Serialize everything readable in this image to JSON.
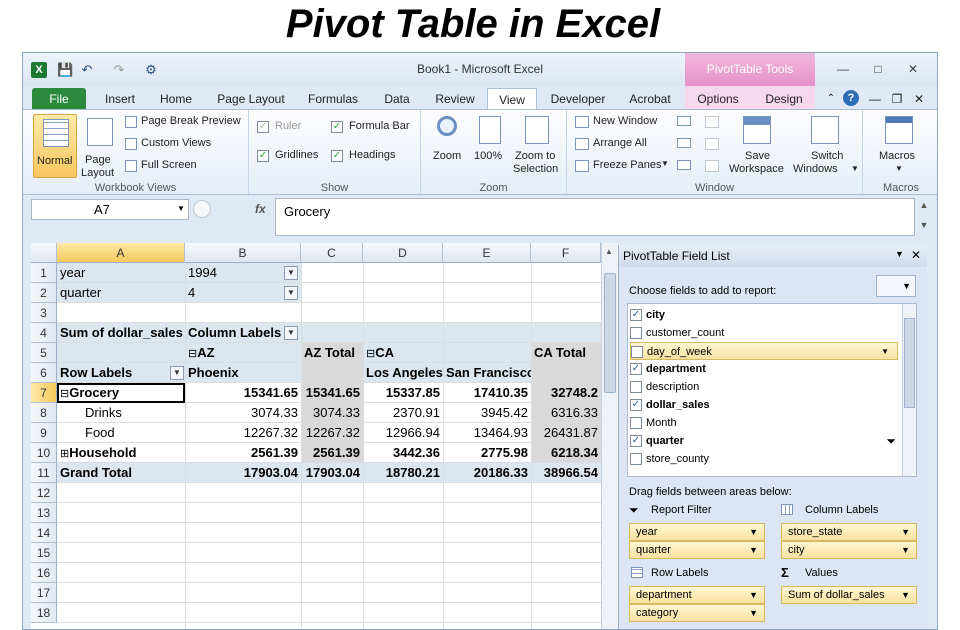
{
  "heading": "Pivot Table in Excel",
  "window": {
    "title": "Book1  -  Microsoft Excel",
    "contextual_tab": "PivotTable Tools",
    "tabs": [
      "File",
      "Insert",
      "Home",
      "Page Layout",
      "Formulas",
      "Data",
      "Review",
      "View",
      "Developer",
      "Acrobat",
      "Options",
      "Design"
    ],
    "active_tab": "View"
  },
  "ribbon": {
    "workbook_views": {
      "label": "Workbook Views",
      "normal": "Normal",
      "page_layout_1": "Page",
      "page_layout_2": "Layout",
      "page_break": "Page Break Preview",
      "custom_views": "Custom Views",
      "full_screen": "Full Screen"
    },
    "show": {
      "label": "Show",
      "ruler": "Ruler",
      "formula_bar": "Formula Bar",
      "gridlines": "Gridlines",
      "headings": "Headings"
    },
    "zoom": {
      "label": "Zoom",
      "zoom": "Zoom",
      "pct": "100%",
      "zoom_sel_1": "Zoom to",
      "zoom_sel_2": "Selection"
    },
    "window": {
      "label": "Window",
      "new_window": "New Window",
      "arrange_all": "Arrange All",
      "freeze_panes": "Freeze Panes",
      "save_ws_1": "Save",
      "save_ws_2": "Workspace",
      "switch_1": "Switch",
      "switch_2": "Windows"
    },
    "macros": {
      "label": "Macros",
      "macros": "Macros"
    }
  },
  "formula_bar": {
    "name_box": "A7",
    "fx": "fx",
    "value": "Grocery"
  },
  "sheet": {
    "columns": [
      "A",
      "B",
      "C",
      "D",
      "E",
      "F"
    ],
    "rows": [
      "1",
      "2",
      "3",
      "4",
      "5",
      "6",
      "7",
      "8",
      "9",
      "10",
      "11",
      "12",
      "13",
      "14",
      "15",
      "16",
      "17",
      "18"
    ],
    "filters": [
      {
        "field": "year",
        "value": "1994"
      },
      {
        "field": "quarter",
        "value": "4"
      }
    ],
    "values_label": "Sum of dollar_sales",
    "column_labels": "Column Labels",
    "row_labels": "Row Labels",
    "states": {
      "az": "AZ",
      "ca": "CA",
      "az_total": "AZ Total",
      "ca_total": "CA Total"
    },
    "cities": [
      "Phoenix",
      "Los Angeles",
      "San Francisco"
    ],
    "data_rows": [
      {
        "label": "Grocery",
        "expander": "⊟",
        "vals": [
          "15341.65",
          "15341.65",
          "15337.85",
          "17410.35",
          "32748.2"
        ]
      },
      {
        "label": "Drinks",
        "expander": "",
        "vals": [
          "3074.33",
          "3074.33",
          "2370.91",
          "3945.42",
          "6316.33"
        ]
      },
      {
        "label": "Food",
        "expander": "",
        "vals": [
          "12267.32",
          "12267.32",
          "12966.94",
          "13464.93",
          "26431.87"
        ]
      },
      {
        "label": "Household",
        "expander": "⊞",
        "vals": [
          "2561.39",
          "2561.39",
          "3442.36",
          "2775.98",
          "6218.34"
        ]
      },
      {
        "label": "Grand Total",
        "expander": "",
        "vals": [
          "17903.04",
          "17903.04",
          "18780.21",
          "20186.33",
          "38966.54"
        ]
      }
    ]
  },
  "field_list": {
    "title": "PivotTable Field List",
    "choose": "Choose fields to add to report:",
    "fields": [
      {
        "name": "city",
        "checked": true
      },
      {
        "name": "customer_count",
        "checked": false
      },
      {
        "name": "day_of_week",
        "checked": false
      },
      {
        "name": "department",
        "checked": true
      },
      {
        "name": "description",
        "checked": false
      },
      {
        "name": "dollar_sales",
        "checked": true
      },
      {
        "name": "Month",
        "checked": false
      },
      {
        "name": "quarter",
        "checked": true
      },
      {
        "name": "store_county",
        "checked": false
      }
    ],
    "drag": "Drag fields between areas below:",
    "report_filter": "Report Filter",
    "column_labels": "Column Labels",
    "row_labels": "Row Labels",
    "values": "Values",
    "filter_items": [
      "year",
      "quarter"
    ],
    "column_items": [
      "store_state",
      "city"
    ],
    "row_items": [
      "department",
      "category"
    ],
    "value_items": [
      "Sum of dollar_sales"
    ]
  }
}
